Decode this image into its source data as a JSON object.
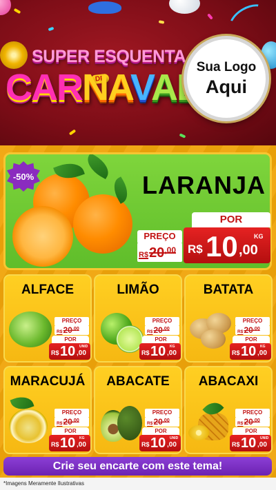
{
  "header": {
    "title_line1": "SUPER ESQUENTA",
    "title_de": "DE",
    "title_line2_parts": [
      "CAR",
      "NA",
      "V",
      "AL"
    ],
    "logo_line1": "Sua Logo",
    "logo_line2": "Aqui"
  },
  "featured": {
    "discount_badge": "-50%",
    "name": "LARANJA",
    "preco_label": "PREÇO",
    "old_currency": "R$",
    "old_int": "20",
    "old_dec": ",00",
    "por_label": "POR",
    "new_currency": "R$",
    "new_int": "10",
    "new_dec": ",00",
    "unit": "KG"
  },
  "products": [
    {
      "name": "ALFACE",
      "preco_label": "PREÇO",
      "old_currency": "R$",
      "old_int": "20",
      "old_dec": ",00",
      "por_label": "POR",
      "new_currency": "R$",
      "new_int": "10",
      "new_dec": ",00",
      "unit": "UNID"
    },
    {
      "name": "LIMÃO",
      "preco_label": "PREÇO",
      "old_currency": "R$",
      "old_int": "20",
      "old_dec": ",00",
      "por_label": "POR",
      "new_currency": "R$",
      "new_int": "10",
      "new_dec": ",00",
      "unit": "KG"
    },
    {
      "name": "BATATA",
      "preco_label": "PREÇO",
      "old_currency": "R$",
      "old_int": "20",
      "old_dec": ",00",
      "por_label": "POR",
      "new_currency": "R$",
      "new_int": "10",
      "new_dec": ",00",
      "unit": "KG"
    },
    {
      "name": "MARACUJÁ",
      "preco_label": "PREÇO",
      "old_currency": "R$",
      "old_int": "20",
      "old_dec": ",00",
      "por_label": "POR",
      "new_currency": "R$",
      "new_int": "10",
      "new_dec": ",00",
      "unit": "KG"
    },
    {
      "name": "ABACATE",
      "preco_label": "PREÇO",
      "old_currency": "R$",
      "old_int": "20",
      "old_dec": ",00",
      "por_label": "POR",
      "new_currency": "R$",
      "new_int": "10",
      "new_dec": ",00",
      "unit": "UNID"
    },
    {
      "name": "ABACAXI",
      "preco_label": "PREÇO",
      "old_currency": "R$",
      "old_int": "20",
      "old_dec": ",00",
      "por_label": "POR",
      "new_currency": "R$",
      "new_int": "10",
      "new_dec": ",00",
      "unit": "UNID"
    }
  ],
  "cta": {
    "label": "Crie seu encarte com este tema!"
  },
  "disclaimer": "*Imagens Meramente Ilustrativas",
  "colors": {
    "price_red": "#c21313",
    "green_panel": "#6cc832",
    "card_yellow": "#ffc81c",
    "cta_purple": "#7a2fc4",
    "header_red": "#7d0d17"
  }
}
